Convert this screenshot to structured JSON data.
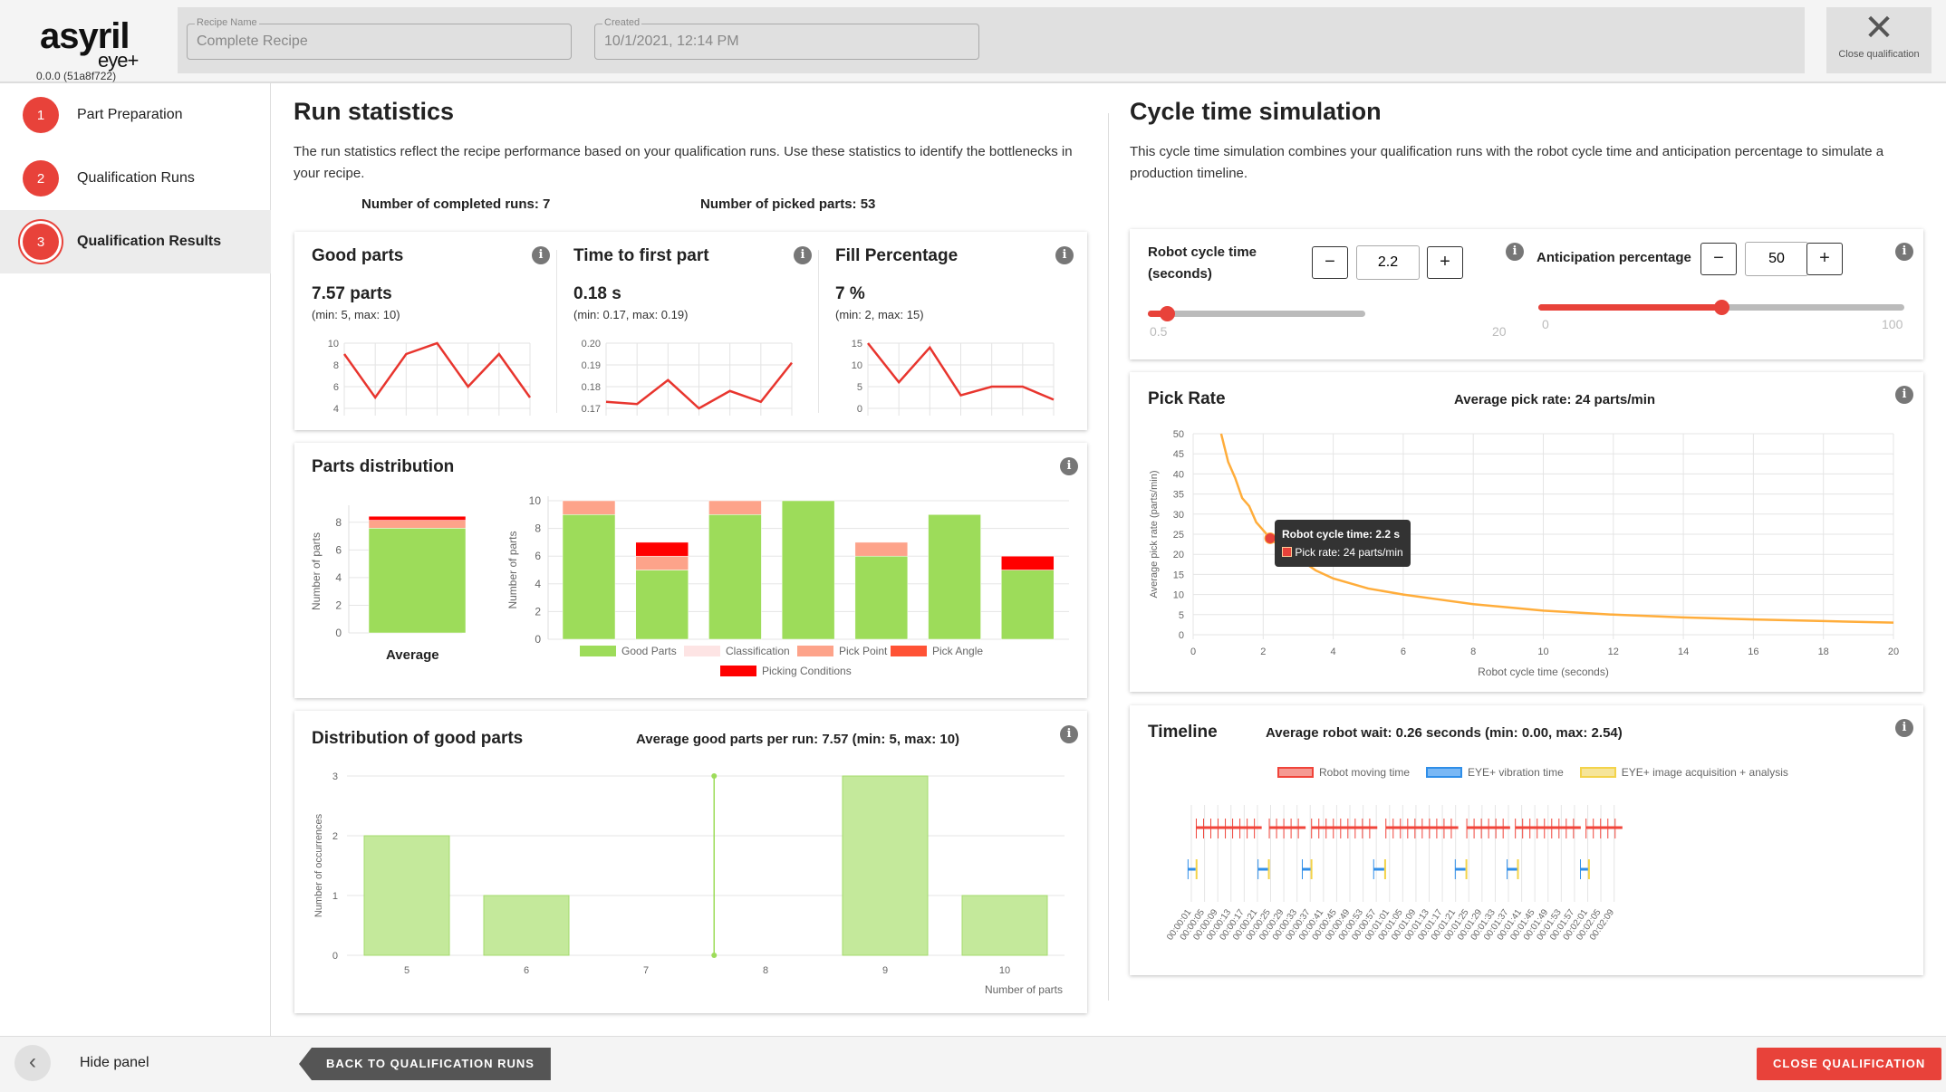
{
  "header": {
    "logo": "asyril",
    "logo_sub": "eye+",
    "version": "0.0.0 (51a8f722)",
    "recipe_label": "Recipe Name",
    "recipe_value": "Complete Recipe",
    "created_label": "Created",
    "created_value": "10/1/2021, 12:14 PM",
    "close_label": "Close qualification"
  },
  "sidebar": {
    "items": [
      {
        "num": "1",
        "label": "Part Preparation"
      },
      {
        "num": "2",
        "label": "Qualification Runs"
      },
      {
        "num": "3",
        "label": "Qualification Results",
        "active": true
      }
    ],
    "hide_label": "Hide panel"
  },
  "footer": {
    "back": "BACK TO QUALIFICATION RUNS",
    "close": "CLOSE QUALIFICATION"
  },
  "run_stats": {
    "title": "Run statistics",
    "description": "The run statistics reflect the recipe performance based on your qualification runs. Use these statistics to identify the bottlenecks in your recipe.",
    "completed_runs": "Number of completed runs: 7",
    "picked_parts": "Number of picked parts: 53",
    "cards": [
      {
        "title": "Good parts",
        "value": "7.57 parts",
        "range": "(min: 5, max: 10)",
        "ylim": [
          4,
          10
        ],
        "ticks": [
          "4",
          "6",
          "8",
          "10"
        ],
        "values": [
          9,
          5,
          9,
          10,
          6,
          9,
          5
        ]
      },
      {
        "title": "Time to first part",
        "value": "0.18 s",
        "range": "(min: 0.17, max: 0.19)",
        "ylim": [
          0.17,
          0.2
        ],
        "ticks": [
          "0.17",
          "0.18",
          "0.19",
          "0.20"
        ],
        "values": [
          0.173,
          0.172,
          0.183,
          0.17,
          0.178,
          0.173,
          0.191
        ]
      },
      {
        "title": "Fill Percentage",
        "value": "7 %",
        "range": "(min: 2, max: 15)",
        "ylim": [
          0,
          15
        ],
        "ticks": [
          "0",
          "5",
          "10",
          "15"
        ],
        "values": [
          15,
          6,
          14,
          3,
          5,
          5,
          2
        ]
      }
    ]
  },
  "parts_distribution": {
    "title": "Parts distribution",
    "average_label": "Average",
    "ylabel": "Number of parts",
    "colors": {
      "Good Parts": "#9ddc5a",
      "Classification": "#fde4e4",
      "Pick Point": "#fda38a",
      "Pick Angle": "#ff5235",
      "Picking Conditions": "#ff0000"
    },
    "legend": [
      "Good Parts",
      "Classification",
      "Pick Point",
      "Pick Angle",
      "Picking Conditions"
    ],
    "average": {
      "Good Parts": 7.57,
      "Classification": 0,
      "Pick Point": 0.57,
      "Pick Angle": 0,
      "Picking Conditions": 0.29
    },
    "avg_ticks": [
      "0",
      "2",
      "4",
      "6",
      "8"
    ],
    "run_ticks": [
      "0",
      "2",
      "4",
      "6",
      "8",
      "10"
    ],
    "runs": [
      {
        "Good Parts": 9,
        "Pick Point": 1
      },
      {
        "Good Parts": 5,
        "Pick Point": 1,
        "Picking Conditions": 1
      },
      {
        "Good Parts": 9,
        "Pick Point": 1
      },
      {
        "Good Parts": 10
      },
      {
        "Good Parts": 6,
        "Pick Point": 1
      },
      {
        "Good Parts": 9
      },
      {
        "Good Parts": 5,
        "Picking Conditions": 1
      }
    ]
  },
  "good_distribution": {
    "title": "Distribution of good parts",
    "summary": "Average good parts per run: 7.57 (min: 5, max: 10)",
    "ylabel": "Number of occurrences",
    "xlabel": "Number of parts",
    "chart_data": {
      "type": "bar",
      "categories": [
        "5",
        "6",
        "7",
        "8",
        "9",
        "10"
      ],
      "values": [
        2,
        1,
        0,
        0,
        3,
        1
      ],
      "ylim": [
        0,
        3
      ],
      "yticks": [
        "0",
        "1",
        "2",
        "3"
      ],
      "average_marker": 7.57
    }
  },
  "cycle": {
    "title": "Cycle time simulation",
    "description": "This cycle time simulation combines your qualification runs with the robot cycle time and anticipation percentage to simulate a production timeline.",
    "robot_label": "Robot cycle time (seconds)",
    "robot_value": "2.2",
    "robot_min": "0.5",
    "robot_max": "20",
    "robot_num": 2.2,
    "antic_label": "Anticipation percentage",
    "antic_value": "50",
    "antic_min": "0",
    "antic_max": "100",
    "antic_num": 50
  },
  "pick_rate": {
    "title": "Pick Rate",
    "summary": "Average pick rate: 24 parts/min",
    "ylabel": "Average pick rate (parts/min)",
    "xlabel": "Robot cycle time (seconds)",
    "tooltip_title": "Robot cycle time: 2.2 s",
    "tooltip_value": "Pick rate: 24 parts/min",
    "chart_data": {
      "type": "line",
      "xlim": [
        0,
        20
      ],
      "ylim": [
        0,
        50
      ],
      "xticks": [
        "0",
        "2",
        "4",
        "6",
        "8",
        "10",
        "12",
        "14",
        "16",
        "18",
        "20"
      ],
      "yticks": [
        "0",
        "5",
        "10",
        "15",
        "20",
        "25",
        "30",
        "35",
        "40",
        "45",
        "50"
      ],
      "color": "#ffad3b",
      "x": [
        0.8,
        1,
        1.2,
        1.4,
        1.6,
        1.8,
        2,
        2.2,
        2.6,
        3,
        3.5,
        4,
        5,
        6,
        7,
        8,
        10,
        12,
        14,
        16,
        18,
        20
      ],
      "y": [
        50,
        43,
        39,
        34,
        32,
        28,
        26,
        24,
        21,
        19,
        16,
        14,
        11.5,
        10,
        8.8,
        7.6,
        6,
        5,
        4.3,
        3.8,
        3.4,
        3
      ],
      "highlight": [
        2.2,
        24
      ]
    }
  },
  "timeline": {
    "title": "Timeline",
    "summary": "Average robot wait: 0.26 seconds (min: 0.00, max: 2.54)",
    "legend": [
      {
        "label": "Robot moving time",
        "color": "#f0443a"
      },
      {
        "label": "EYE+ vibration time",
        "color": "#2f8ee8"
      },
      {
        "label": "EYE+ image acquisition + analysis",
        "color": "#f3d34a"
      }
    ],
    "labels": [
      "00:00:01",
      "00:00:05",
      "00:00:09",
      "00:00:13",
      "00:00:17",
      "00:00:21",
      "00:00:25",
      "00:00:29",
      "00:00:33",
      "00:00:37",
      "00:00:41",
      "00:00:45",
      "00:00:49",
      "00:00:53",
      "00:00:57",
      "00:01:01",
      "00:01:05",
      "00:01:09",
      "00:01:13",
      "00:01:17",
      "00:01:21",
      "00:01:25",
      "00:01:29",
      "00:01:33",
      "00:01:37",
      "00:01:41",
      "00:01:45",
      "00:01:49",
      "00:01:53",
      "00:01:57",
      "00:02:01",
      "00:02:05",
      "00:02:09"
    ],
    "robot": [
      [
        2.5,
        22.3
      ],
      [
        24.6,
        35.6
      ],
      [
        37.4,
        57.3
      ],
      [
        59.9,
        81.8
      ],
      [
        84.4,
        97.5
      ],
      [
        99.1,
        118.9
      ],
      [
        120.5,
        131.5
      ]
    ],
    "vibration": [
      [
        0,
        2.3
      ],
      [
        21.2,
        24.2
      ],
      [
        34.6,
        37.1
      ],
      [
        56.2,
        59.4
      ],
      [
        80.9,
        84
      ],
      [
        96.6,
        99.6
      ],
      [
        118.8,
        121.1
      ]
    ],
    "acquisition": [
      [
        2.3,
        2.7
      ],
      [
        24.2,
        24.6
      ],
      [
        37.1,
        37.5
      ],
      [
        59.4,
        59.8
      ],
      [
        84,
        84.4
      ],
      [
        99.6,
        100
      ],
      [
        121.1,
        121.5
      ]
    ]
  }
}
